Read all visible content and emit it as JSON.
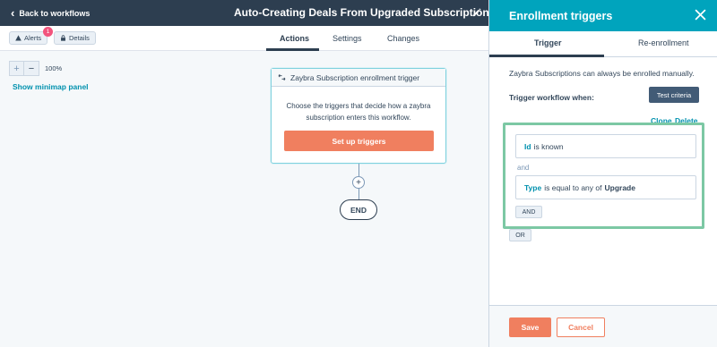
{
  "header": {
    "back_label": "Back to workflows",
    "workflow_title": "Auto-Creating Deals From Upgraded Subscriptions"
  },
  "subbar": {
    "alerts_label": "Alerts",
    "alerts_count": "1",
    "details_label": "Details",
    "tabs": [
      {
        "label": "Actions",
        "active": true
      },
      {
        "label": "Settings",
        "active": false
      },
      {
        "label": "Changes",
        "active": false
      }
    ]
  },
  "canvas": {
    "zoom_in": "+",
    "zoom_out": "−",
    "zoom_level": "100%",
    "minimap_link": "Show minimap panel",
    "trigger_card": {
      "title": "Zaybra Subscription enrollment trigger",
      "description": "Choose the triggers that decide how a zaybra subscription enters this workflow.",
      "button_label": "Set up triggers"
    },
    "add_action": "+",
    "end_label": "END"
  },
  "panel": {
    "title": "Enrollment triggers",
    "tabs": [
      {
        "label": "Trigger",
        "active": true
      },
      {
        "label": "Re-enrollment",
        "active": false
      }
    ],
    "note": "Zaybra Subscriptions can always be enrolled manually.",
    "trigger_when": "Trigger workflow when:",
    "test_button": "Test criteria",
    "clone": "Clone",
    "delete": "Delete",
    "conditions": [
      {
        "property": "Id",
        "operator": "is known",
        "value": ""
      },
      {
        "property": "Type",
        "operator": "is equal to any of",
        "value": "Upgrade"
      }
    ],
    "and_label": "and",
    "and_button": "AND",
    "or_button": "OR",
    "save": "Save",
    "cancel": "Cancel"
  },
  "colors": {
    "topbar": "#2d3e50",
    "panel_header": "#00a4bd",
    "primary_button": "#f07f5f",
    "link": "#0091ae",
    "highlight_border": "#7cc8a4",
    "badge": "#f2547d"
  }
}
